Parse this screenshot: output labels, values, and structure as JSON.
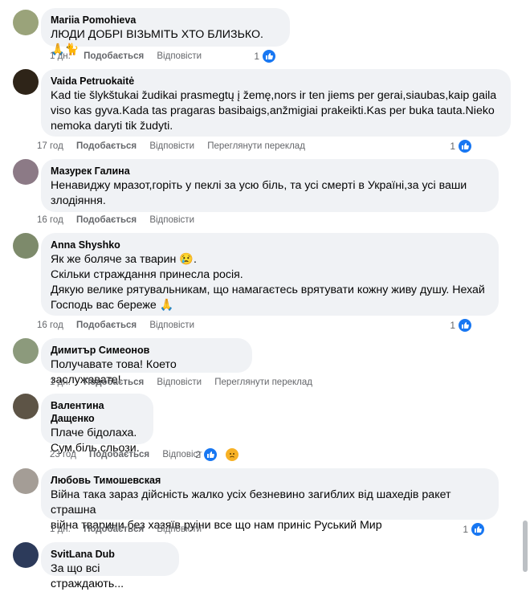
{
  "comments": [
    {
      "author": "Mariia Pomohieva",
      "lines": [
        "ЛЮДИ ДОБРІ ВІЗЬМІТЬ ХТО БЛИЗЬКО. 🙏🐈"
      ],
      "time": "1 дн.",
      "like_label": "Подобається",
      "reply_label": "Відповісти",
      "translate_label": "",
      "reaction_count": "1",
      "avatar_color": "#9aa37a"
    },
    {
      "author": "Vaida Petruokaitė",
      "lines": [
        "Kad tie šlykštukai žudikai prasmegtų į žemę,nors ir ten jiems per gerai,siaubas,kaip gaila",
        "viso kas gyva.Kada tas pragaras basibaigs,anžmigiai prakeikti.Kas per buka tauta.Nieko",
        "nemoka daryti tik žudyti."
      ],
      "time": "17 год",
      "like_label": "Подобається",
      "reply_label": "Відповісти",
      "translate_label": "Переглянути переклад",
      "reaction_count": "1",
      "avatar_color": "#2e2418"
    },
    {
      "author": "Мазурек Галина",
      "lines": [
        "Ненавиджу мразот,горіть у пеклі за усю біль, та усі смерті в Україні,за усі ваши",
        "злодіяння."
      ],
      "time": "16 год",
      "like_label": "Подобається",
      "reply_label": "Відповісти",
      "translate_label": "",
      "reaction_count": "",
      "avatar_color": "#8c7a86"
    },
    {
      "author": "Anna Shyshko",
      "lines": [
        "Як же боляче за тварин 😢.",
        "Скільки страждання принесла росія.",
        "Дякую велике рятувальникам, що намагаєтесь врятувати кожну живу душу. Нехай",
        "Господь вас береже 🙏"
      ],
      "time": "16 год",
      "like_label": "Подобається",
      "reply_label": "Відповісти",
      "translate_label": "",
      "reaction_count": "1",
      "avatar_color": "#7d8a6b"
    },
    {
      "author": "Димитър Симеонов",
      "lines": [
        "Получавате това! Което заслужавате!"
      ],
      "time": "1 дн.",
      "like_label": "Подобається",
      "reply_label": "Відповісти",
      "translate_label": "Переглянути переклад",
      "reaction_count": "",
      "avatar_color": "#8c9a7c"
    },
    {
      "author": "Валентина Дащенко",
      "lines": [
        "Плаче бідолаха.",
        "Сум,біль,сльози."
      ],
      "time": "23 год",
      "like_label": "Подобається",
      "reply_label": "Відповісти",
      "translate_label": "",
      "reaction_count": "2",
      "avatar_color": "#5d5446"
    },
    {
      "author": "Любовь Тимошевская",
      "lines": [
        "Війна така зараз дійсність жалко усіх безневино загиблих від шахедів ракет страшна",
        "війна тварини без хазяїв руіни все що нам приніс Руський Мир"
      ],
      "time": "1 дн.",
      "like_label": "Подобається",
      "reply_label": "Відповісти",
      "translate_label": "",
      "reaction_count": "1",
      "avatar_color": "#a49d96"
    },
    {
      "author": "SvitLana Dub",
      "lines": [
        "За що всі страждають..."
      ],
      "time": "",
      "like_label": "",
      "reply_label": "",
      "translate_label": "",
      "reaction_count": "",
      "avatar_color": "#2c3a5a"
    }
  ],
  "colors": {
    "like_blue": "#1877f2",
    "bubble_bg": "#f0f2f5",
    "meta_gray": "#65676b"
  }
}
